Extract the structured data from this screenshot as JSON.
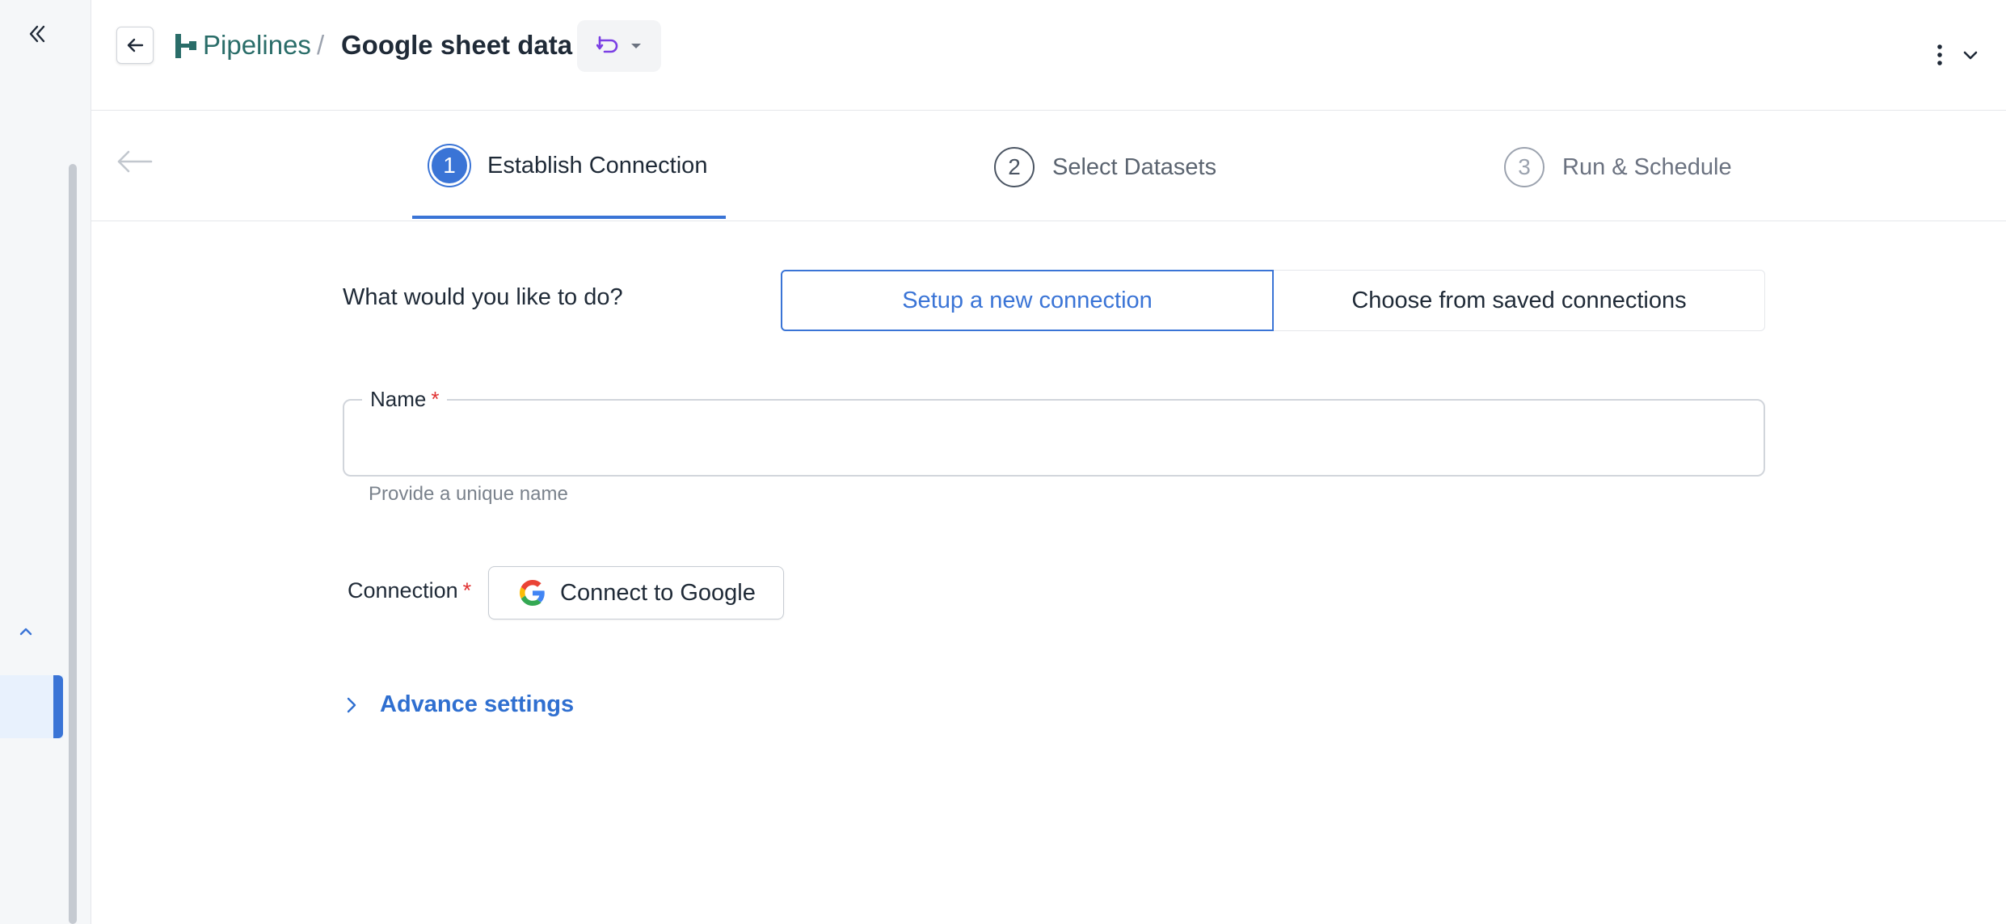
{
  "header": {
    "breadcrumb_parent": "Pipelines",
    "breadcrumb_separator": "/",
    "title": "Google sheet data"
  },
  "stepper": {
    "steps": [
      {
        "number": "1",
        "label": "Establish Connection",
        "state": "active"
      },
      {
        "number": "2",
        "label": "Select Datasets",
        "state": "upcoming"
      },
      {
        "number": "3",
        "label": "Run & Schedule",
        "state": "upcoming"
      }
    ]
  },
  "form": {
    "question": "What would you like to do?",
    "toggle_new": "Setup a new connection",
    "toggle_saved": "Choose from saved connections",
    "selected_option": "Setup a new connection",
    "name_label": "Name",
    "name_required": "*",
    "name_value": "",
    "name_help": "Provide a unique name",
    "connection_label": "Connection",
    "connection_required": "*",
    "connect_button": "Connect to Google",
    "advance_settings": "Advance settings"
  },
  "colors": {
    "accent": "#3a74d6",
    "link_teal": "#2a6d69",
    "required_red": "#e03131",
    "version_icon": "#7b3fe4"
  },
  "icons": {
    "sidebar_collapse": "double-chevron-left-icon",
    "back": "arrow-left-icon",
    "pipeline": "pipeline-icon",
    "version": "version-branch-icon",
    "more": "more-vertical-icon",
    "expand": "chevron-down-icon",
    "google": "google-logo-icon",
    "advance": "chevron-right-icon"
  }
}
